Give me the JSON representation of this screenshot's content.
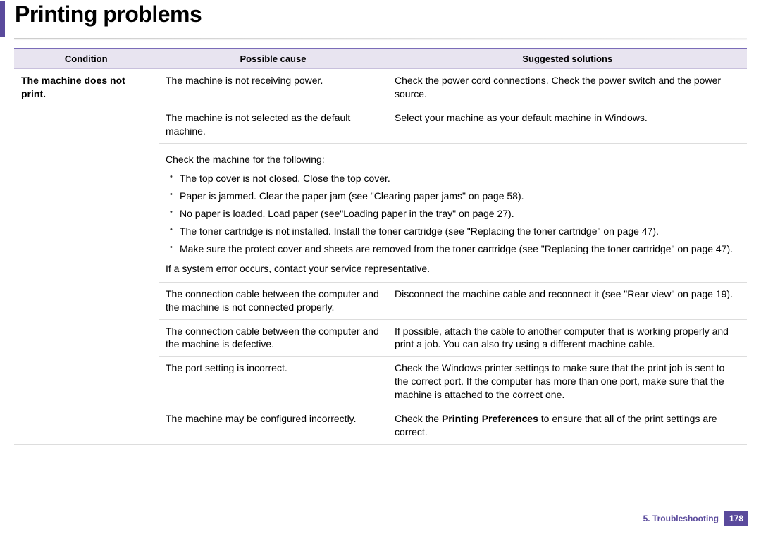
{
  "title": "Printing problems",
  "headers": {
    "condition": "Condition",
    "cause": "Possible cause",
    "solution": "Suggested solutions"
  },
  "condition": "The machine does not print.",
  "rows": {
    "r1": {
      "cause": "The machine is not receiving power.",
      "solution": "Check the power cord connections. Check the power switch and the power source."
    },
    "r2": {
      "cause": "The machine is not selected as the default machine.",
      "solution": "Select your machine as your default machine in Windows."
    },
    "check": {
      "intro": "Check the machine for the following:",
      "items": [
        "The top cover is not closed. Close the top cover.",
        "Paper is jammed. Clear the paper jam (see \"Clearing paper jams\" on page 58).",
        "No paper is loaded. Load paper (see\"Loading paper in the tray\" on page 27).",
        "The toner cartridge is not installed. Install the toner cartridge (see \"Replacing the toner cartridge\" on page 47).",
        "Make sure the protect cover and sheets are removed from the toner cartridge (see \"Replacing the toner cartridge\" on page 47)."
      ],
      "outro": "If a system error occurs, contact your service representative."
    },
    "r4": {
      "cause": "The connection cable between the computer and the machine is not connected properly.",
      "solution": "Disconnect the machine cable and reconnect it (see \"Rear view\" on page 19)."
    },
    "r5": {
      "cause": "The connection cable between the computer and the machine is defective.",
      "solution": "If possible, attach the cable to another computer that is working properly and print a job. You can also try using a different machine cable."
    },
    "r6": {
      "cause": "The port setting is incorrect.",
      "solution": "Check the Windows printer settings to make sure that the print job is sent to the correct port. If the computer has more than one port, make sure that the machine is attached to the correct one."
    },
    "r7": {
      "cause": "The machine may be configured incorrectly.",
      "solution_pre": "Check the ",
      "solution_bold": "Printing Preferences",
      "solution_post": " to ensure that all of the print settings are correct."
    }
  },
  "footer": {
    "chapter": "5.  Troubleshooting",
    "page": "178"
  }
}
